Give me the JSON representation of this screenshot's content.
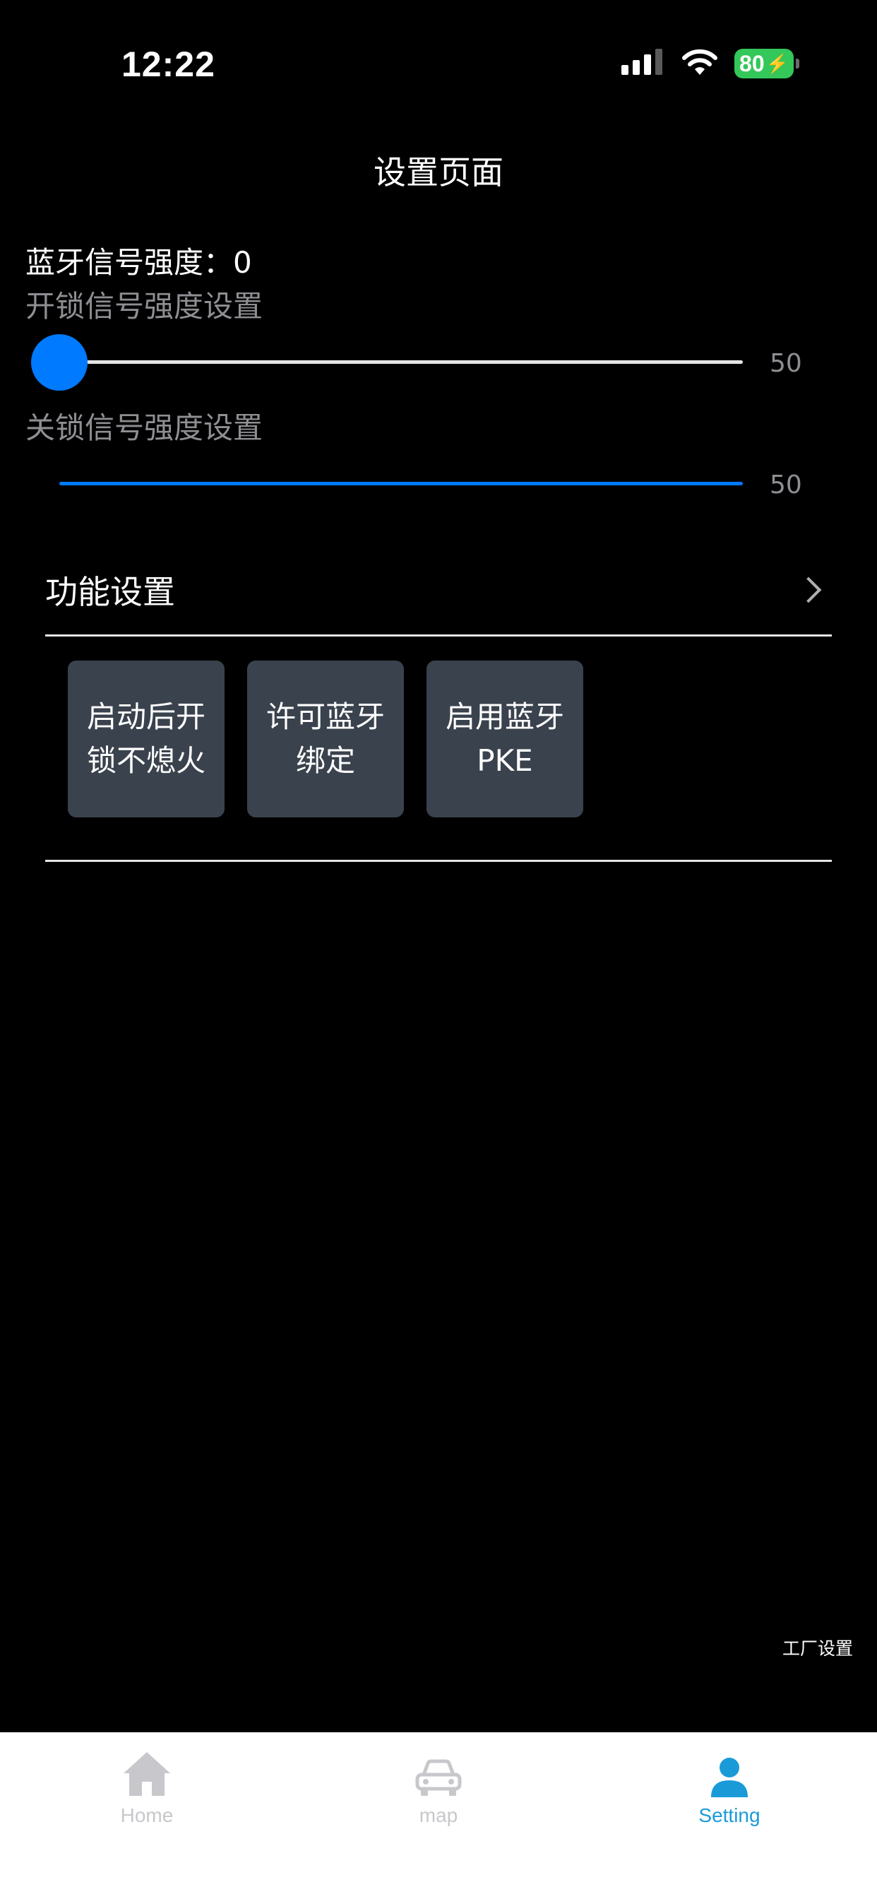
{
  "status_bar": {
    "time": "12:22",
    "battery": "80",
    "signal_icon": "cellular-signal-icon",
    "wifi_icon": "wifi-icon",
    "battery_icon": "battery-charging-icon"
  },
  "header": {
    "title": "设置页面"
  },
  "bluetooth": {
    "strength_label": "蓝牙信号强度：0"
  },
  "unlock_slider": {
    "label": "开锁信号强度设置",
    "value_text": "50",
    "fill_fraction": 0.0
  },
  "lock_slider": {
    "label": "关锁信号强度设置",
    "value_text": "50",
    "fill_fraction": 1.0
  },
  "functions": {
    "title": "功能设置",
    "buttons": [
      {
        "label": "启动后开\n锁不熄火"
      },
      {
        "label": "许可蓝牙\n绑定"
      },
      {
        "label": "启用蓝牙\nPKE"
      }
    ]
  },
  "factory": {
    "label": "工厂设置"
  },
  "tabbar": {
    "items": [
      {
        "label": "Home",
        "icon": "home-icon",
        "active": false
      },
      {
        "label": "map",
        "icon": "car-icon",
        "active": false
      },
      {
        "label": "Setting",
        "icon": "user-icon",
        "active": true
      }
    ]
  },
  "colors": {
    "accent": "#007aff",
    "tab_active": "#1a9bd7",
    "tab_inactive": "#c8c8cc",
    "button_bg": "#3a424d",
    "battery": "#34c759"
  }
}
